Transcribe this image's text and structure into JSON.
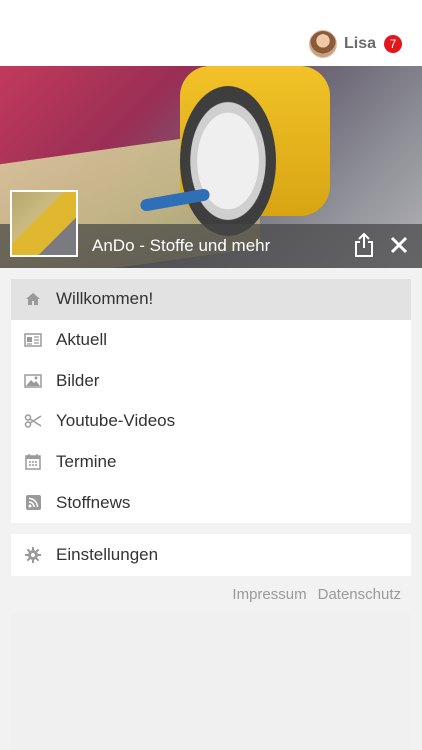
{
  "header": {
    "user_name": "Lisa",
    "notification_count": "7",
    "badge_color": "#e3161c"
  },
  "hero": {
    "title": "AnDo - Stoffe und mehr"
  },
  "menu": {
    "items": [
      {
        "label": "Willkommen!",
        "icon": "home-icon",
        "active": true
      },
      {
        "label": "Aktuell",
        "icon": "newspaper-icon",
        "active": false
      },
      {
        "label": "Bilder",
        "icon": "image-icon",
        "active": false
      },
      {
        "label": "Youtube-Videos",
        "icon": "scissors-icon",
        "active": false
      },
      {
        "label": "Termine",
        "icon": "calendar-icon",
        "active": false
      },
      {
        "label": "Stoffnews",
        "icon": "rss-icon",
        "active": false
      }
    ],
    "settings_label": "Einstellungen"
  },
  "footer": {
    "impressum": "Impressum",
    "datenschutz": "Datenschutz"
  },
  "colors": {
    "active_bg": "#e2e2e2",
    "icon_gray": "#9a9a9a"
  }
}
